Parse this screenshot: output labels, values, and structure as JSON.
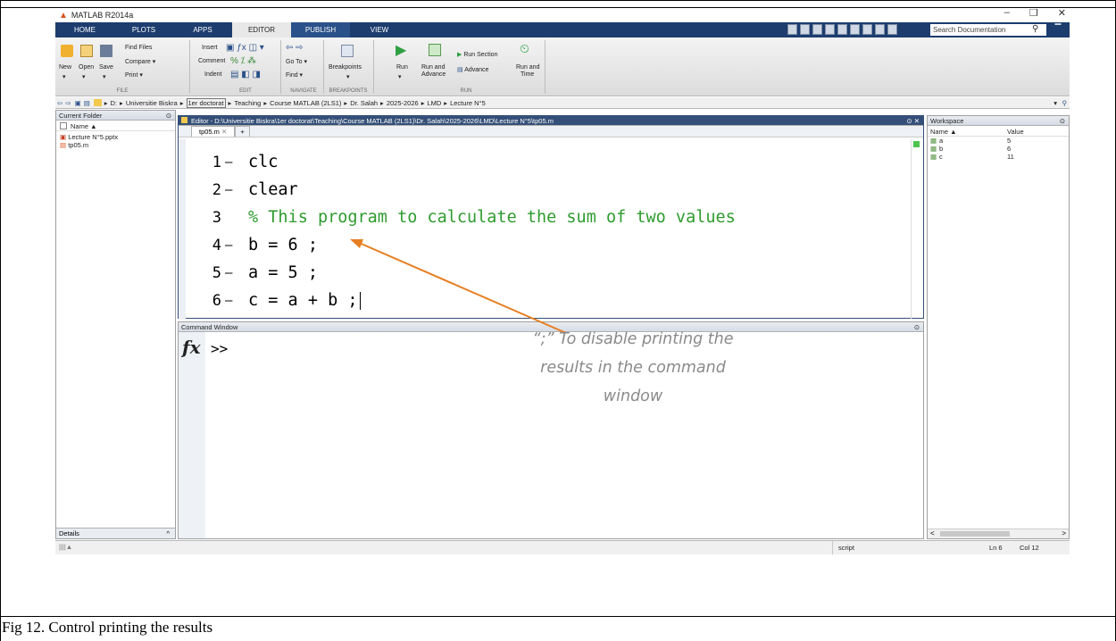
{
  "window": {
    "title": "MATLAB R2014a",
    "controls": [
      "–",
      "❐",
      "✕"
    ]
  },
  "tabs": [
    {
      "label": "HOME"
    },
    {
      "label": "PLOTS"
    },
    {
      "label": "APPS"
    },
    {
      "label": "EDITOR"
    },
    {
      "label": "PUBLISH"
    },
    {
      "label": "VIEW"
    }
  ],
  "search": {
    "placeholder": "Search Documentation"
  },
  "ribbon": {
    "file": {
      "new": "New",
      "open": "Open",
      "save": "Save",
      "find_files": "Find Files",
      "compare": "Compare ▾",
      "print": "Print ▾",
      "section": "FILE"
    },
    "edit": {
      "insert": "Insert",
      "comment": "Comment",
      "indent": "Indent",
      "section": "EDIT"
    },
    "navigate": {
      "goto": "Go To ▾",
      "find": "Find ▾",
      "section": "NAVIGATE"
    },
    "breakpoints": {
      "label": "Breakpoints",
      "section": "BREAKPOINTS"
    },
    "run": {
      "run": "Run",
      "run_advance_1": "Run and",
      "run_advance_2": "Advance",
      "run_section": "Run Section",
      "advance": "Advance",
      "run_time_1": "Run and",
      "run_time_2": "Time",
      "section": "RUN"
    }
  },
  "path": [
    "D:",
    "Universitie Biskra",
    "1er doctorat",
    "Teaching",
    "Course MATLAB (2LS1)",
    "Dr. Salah",
    "2025-2026",
    "LMD",
    "Lecture N°5"
  ],
  "current_folder": {
    "title": "Current Folder",
    "column": "Name ▲",
    "files": [
      "Lecture N°5.pptx",
      "tp05.m"
    ],
    "details": "Details"
  },
  "editor": {
    "title": "Editor - D:\\Universitie Biskra\\1er doctorat\\Teaching\\Course MATLAB (2LS1)\\Dr. Salah\\2025-2026\\LMD\\Lecture N°5\\tp05.m",
    "tab": "tp05.m",
    "lines": [
      {
        "n": "1",
        "dash": "—",
        "text": "clc",
        "comment": false
      },
      {
        "n": "2",
        "dash": "—",
        "text": "clear",
        "comment": false
      },
      {
        "n": "3",
        "dash": "",
        "text": "% This program to calculate the sum of two values",
        "comment": true
      },
      {
        "n": "4",
        "dash": "—",
        "text": "b = 6 ;",
        "comment": false
      },
      {
        "n": "5",
        "dash": "—",
        "text": "a = 5 ;",
        "comment": false
      },
      {
        "n": "6",
        "dash": "—",
        "text": "c = a + b ;",
        "comment": false
      }
    ]
  },
  "command_window": {
    "title": "Command Window",
    "prompt": ">>",
    "fx": "fx"
  },
  "workspace": {
    "title": "Workspace",
    "col_name": "Name ▲",
    "col_value": "Value",
    "vars": [
      {
        "name": "a",
        "value": "5"
      },
      {
        "name": "b",
        "value": "6"
      },
      {
        "name": "c",
        "value": "11"
      }
    ]
  },
  "annotation": {
    "line1": "“;” To disable printing the",
    "line2": "results in the command",
    "line3": "window",
    "color": "#e67e22"
  },
  "status": {
    "mode": "script",
    "ln": "Ln  6",
    "col": "Col  12"
  },
  "caption": "Fig 12. Control printing the results"
}
